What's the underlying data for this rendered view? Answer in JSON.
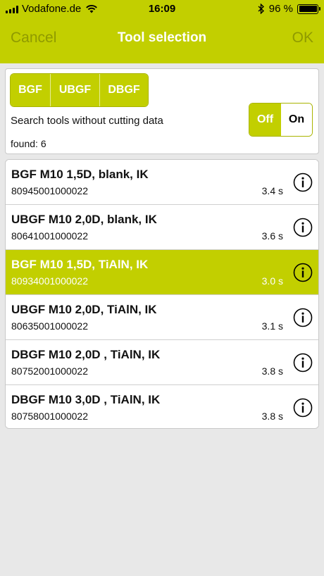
{
  "status_bar": {
    "carrier": "Vodafone.de",
    "time": "16:09",
    "battery": "96 %"
  },
  "nav": {
    "cancel": "Cancel",
    "title": "Tool selection",
    "ok": "OK"
  },
  "filter": {
    "segments": [
      "BGF",
      "UBGF",
      "DBGF"
    ],
    "search_label": "Search tools without cutting data",
    "toggle_off": "Off",
    "toggle_on": "On",
    "found": "found: 6"
  },
  "tools": [
    {
      "name": "BGF M10 1,5D, blank, IK",
      "number": "80945001000022",
      "time": "3.4 s",
      "selected": false
    },
    {
      "name": "UBGF M10 2,0D, blank, IK",
      "number": "80641001000022",
      "time": "3.6 s",
      "selected": false
    },
    {
      "name": "BGF M10 1,5D, TiAlN, IK",
      "number": "80934001000022",
      "time": "3.0 s",
      "selected": true
    },
    {
      "name": "UBGF M10 2,0D, TiAlN, IK",
      "number": "80635001000022",
      "time": "3.1 s",
      "selected": false
    },
    {
      "name": "DBGF M10 2,0D , TiAlN, IK",
      "number": "80752001000022",
      "time": "3.8 s",
      "selected": false
    },
    {
      "name": "DBGF M10 3,0D , TiAlN, IK",
      "number": "80758001000022",
      "time": "3.8 s",
      "selected": false
    }
  ],
  "colors": {
    "accent": "#c2cf00",
    "nav_button": "#8f9a00",
    "background": "#e8e8e8"
  },
  "icons": {
    "signal": "signal-icon",
    "wifi": "wifi-icon",
    "bluetooth": "bluetooth-icon",
    "battery": "battery-icon",
    "info": "info-icon"
  }
}
